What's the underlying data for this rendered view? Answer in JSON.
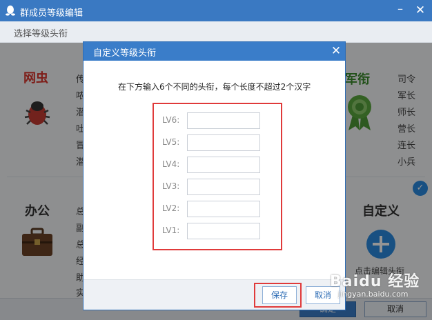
{
  "window": {
    "title": "群成员等级编辑"
  },
  "subheader": {
    "label": "选择等级头衔"
  },
  "categories": {
    "wangchong": {
      "name": "网虫",
      "items": [
        "传",
        "哝",
        "潜",
        "吐",
        "冒",
        "潜"
      ]
    },
    "junxian": {
      "name": "军衔",
      "items": [
        "司令",
        "军长",
        "师长",
        "营长",
        "连长",
        "小兵"
      ]
    },
    "bangong": {
      "name": "办公",
      "items": [
        "总",
        "副",
        "总",
        "经",
        "助",
        "实"
      ]
    },
    "zidingyi": {
      "name": "自定义",
      "action_label": "点击编辑头衔"
    }
  },
  "main_footer": {
    "confirm_label": "确定",
    "cancel_label": "取消"
  },
  "dialog": {
    "title": "自定义等级头衔",
    "instruction": "在下方输入6个不同的头衔，每个长度不超过2个汉字",
    "levels": [
      {
        "label": "LV6:",
        "value": ""
      },
      {
        "label": "LV5:",
        "value": ""
      },
      {
        "label": "LV4:",
        "value": ""
      },
      {
        "label": "LV3:",
        "value": ""
      },
      {
        "label": "LV2:",
        "value": ""
      },
      {
        "label": "LV1:",
        "value": ""
      }
    ],
    "save_label": "保存",
    "cancel_label": "取消"
  },
  "watermark": {
    "brand": "Baidu 经验",
    "url": "jingyan.baidu.com"
  },
  "colors": {
    "title_bar": "#3a79c2",
    "dialog_title": "#3a7dc9",
    "highlight_red": "#e03a3a",
    "wangchong_red": "#d9342b",
    "junxian_green": "#3a8a2c",
    "accent_blue": "#2a8be0"
  }
}
